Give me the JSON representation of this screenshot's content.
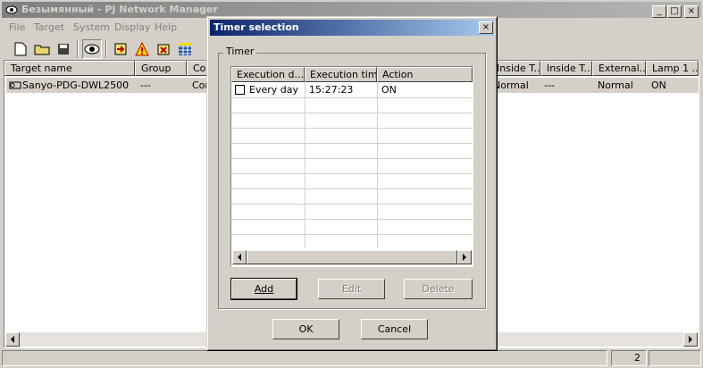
{
  "main_window": {
    "title": "Безымянный - PJ Network Manager",
    "caption_buttons": [
      "_",
      "□",
      "×"
    ],
    "menu": [
      "File",
      "Target",
      "System",
      "Display",
      "Help"
    ],
    "list": {
      "columns": [
        "Target name",
        "Group",
        "Cor",
        "Inside T...",
        "Inside T...",
        "External...",
        "Lamp 1 ..."
      ],
      "rows": [
        {
          "name": "Sanyo-PDG-DWL2500",
          "group": "---",
          "col3": "Cor",
          "inside1": "Normal",
          "inside2": "---",
          "external": "Normal",
          "lamp1": "ON"
        }
      ]
    },
    "status": {
      "count": "2"
    }
  },
  "dialog": {
    "title": "Timer selection",
    "close_label": "×",
    "group_label": "Timer",
    "grid": {
      "columns": [
        "Execution d...",
        "Execution time",
        "Action"
      ],
      "rows": [
        {
          "day": "Every day",
          "time": "15:27:23",
          "action": "ON",
          "checked": false
        }
      ]
    },
    "buttons": {
      "add": "Add",
      "edit": "Edit",
      "delete": "Delete",
      "ok": "OK",
      "cancel": "Cancel"
    }
  },
  "icons": [
    "app-eye-icon",
    "new-file-icon",
    "open-folder-icon",
    "save-icon",
    "view-eye-icon",
    "connect-icon",
    "warning-icon",
    "wizard-icon",
    "grid-icon"
  ]
}
